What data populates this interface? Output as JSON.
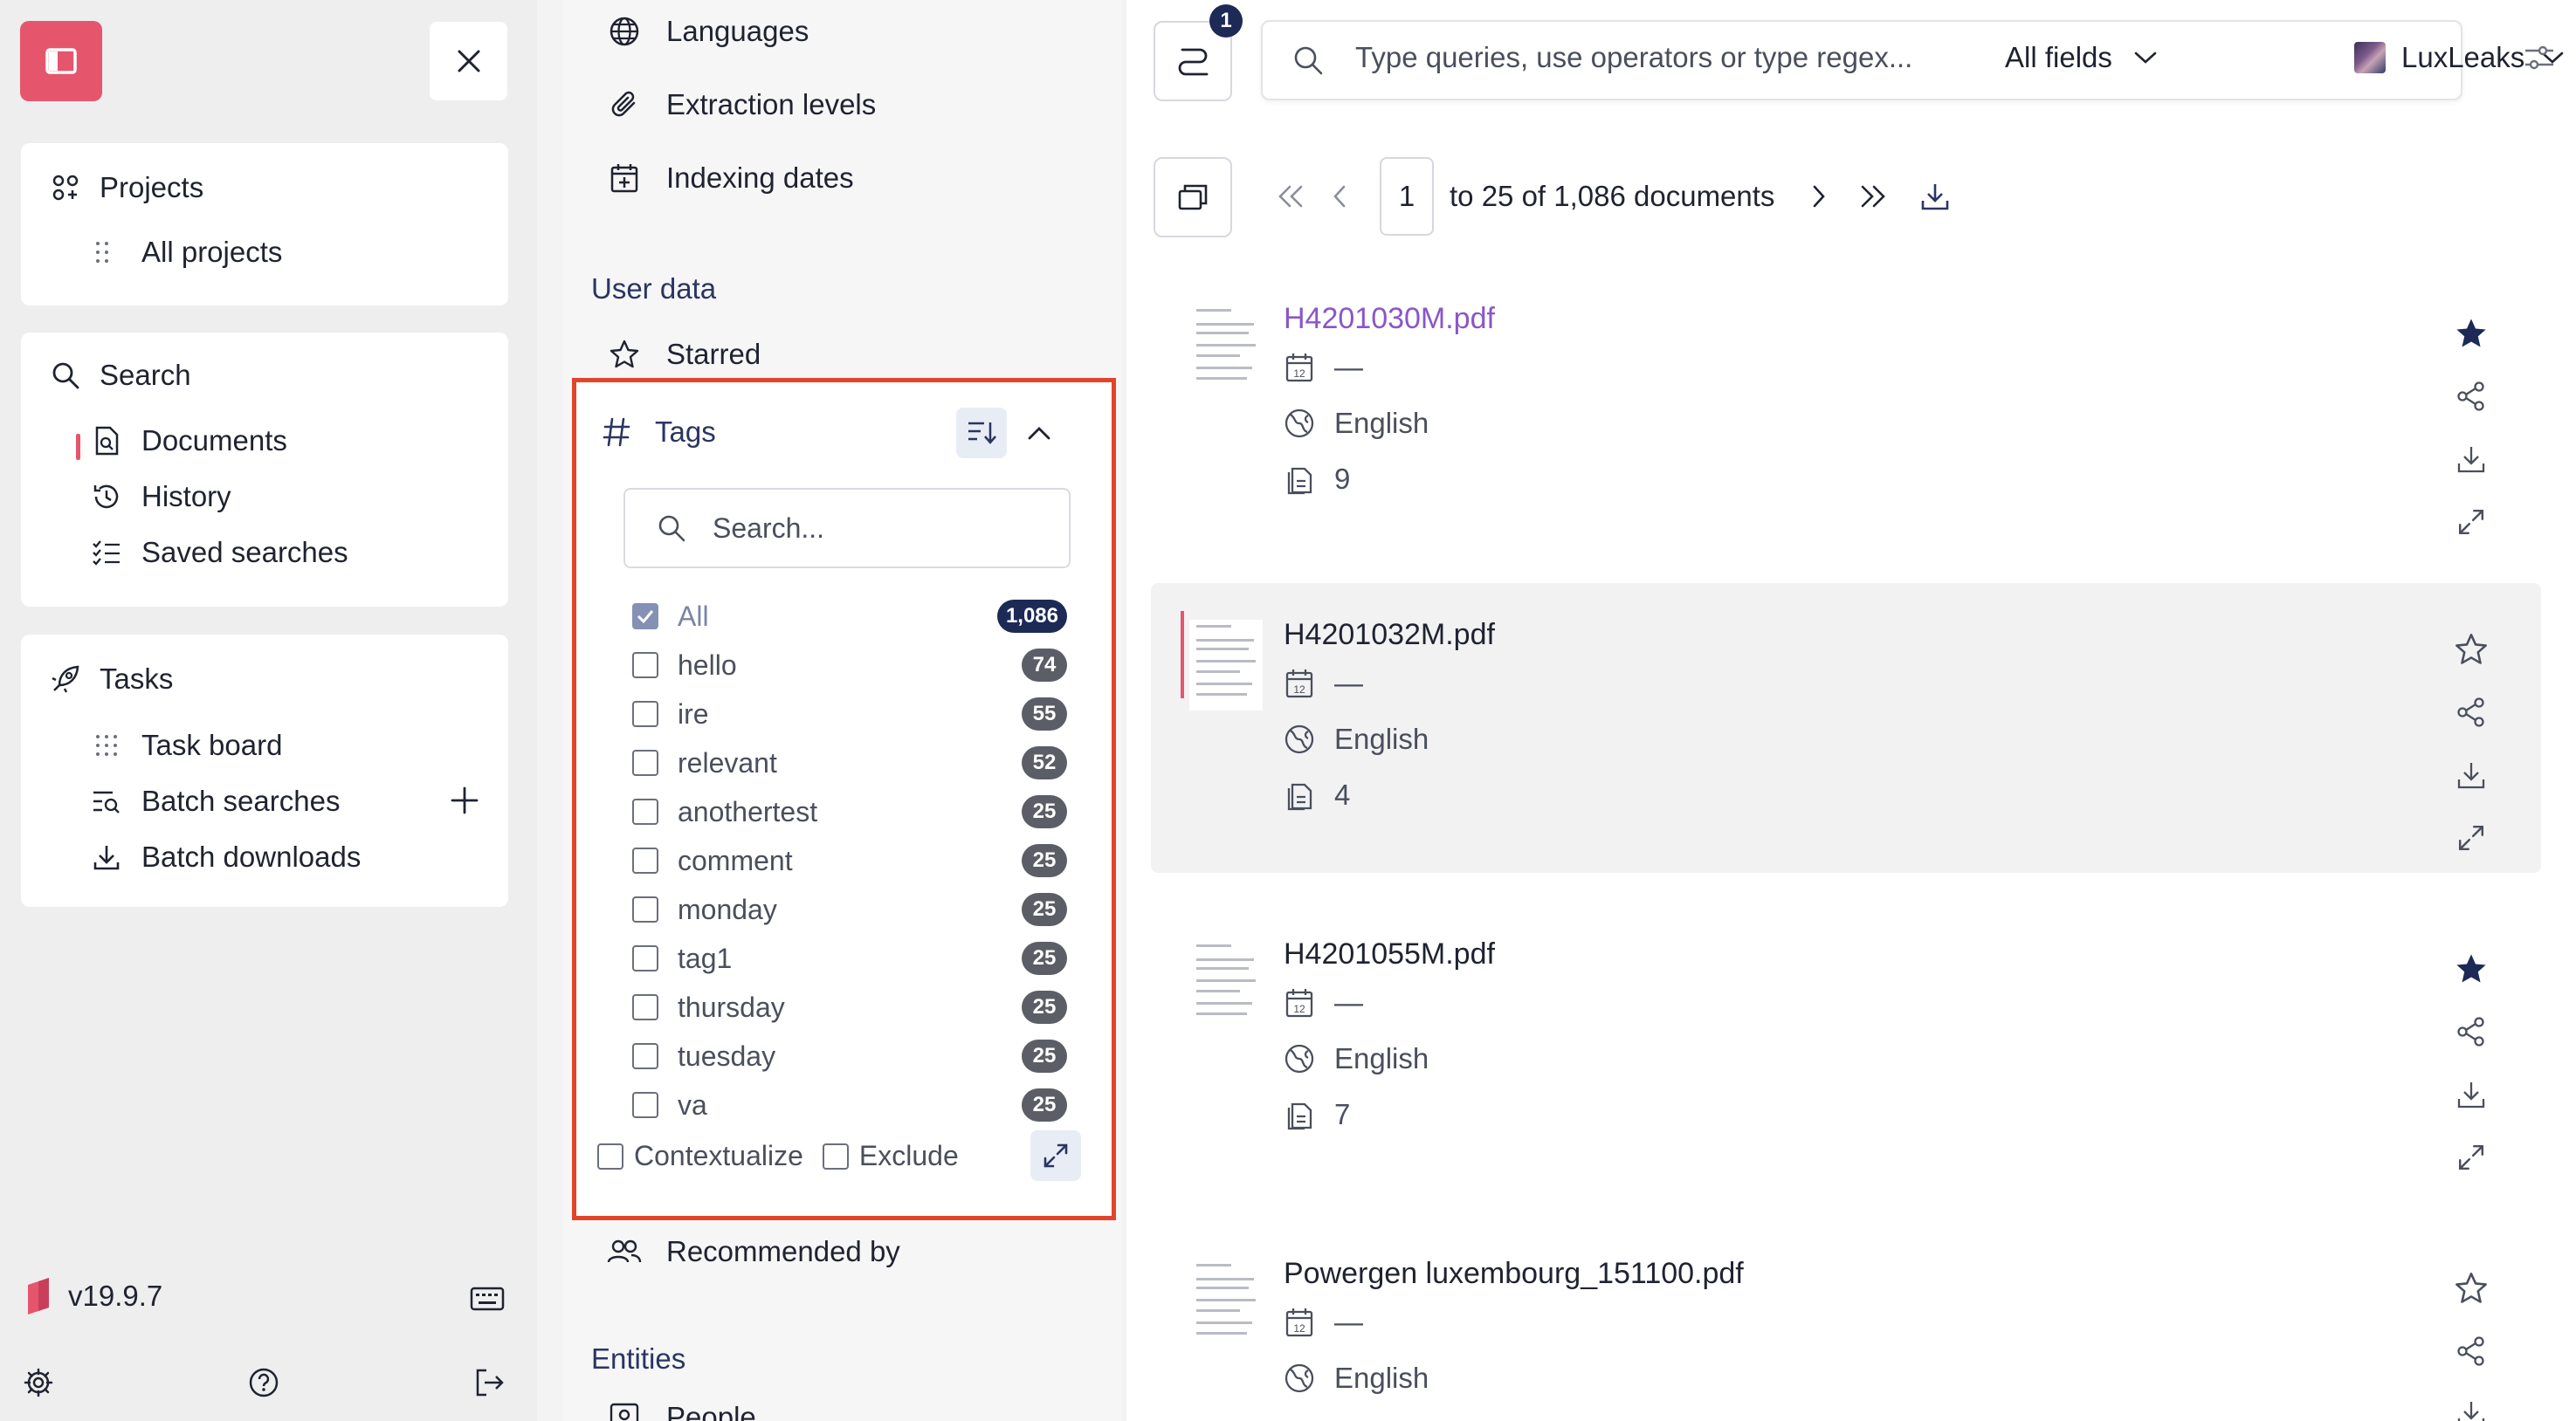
{
  "nav": {
    "projects": {
      "title": "Projects",
      "items": [
        "All projects"
      ]
    },
    "search": {
      "title": "Search",
      "items": [
        "Documents",
        "History",
        "Saved searches"
      ]
    },
    "tasks": {
      "title": "Tasks",
      "items": [
        "Task board",
        "Batch searches",
        "Batch downloads"
      ]
    },
    "version": "v19.9.7",
    "colors": {
      "brand": "#e5566d"
    }
  },
  "filters": {
    "top_items": [
      "Languages",
      "Extraction levels",
      "Indexing dates"
    ],
    "user_data_title": "User data",
    "starred": "Starred",
    "tags": {
      "title": "Tags",
      "search_placeholder": "Search...",
      "items": [
        {
          "label": "All",
          "count": "1,086",
          "checked": true
        },
        {
          "label": "hello",
          "count": "74",
          "checked": false
        },
        {
          "label": "ire",
          "count": "55",
          "checked": false
        },
        {
          "label": "relevant",
          "count": "52",
          "checked": false
        },
        {
          "label": "anothertest",
          "count": "25",
          "checked": false
        },
        {
          "label": "comment",
          "count": "25",
          "checked": false
        },
        {
          "label": "monday",
          "count": "25",
          "checked": false
        },
        {
          "label": "tag1",
          "count": "25",
          "checked": false
        },
        {
          "label": "thursday",
          "count": "25",
          "checked": false
        },
        {
          "label": "tuesday",
          "count": "25",
          "checked": false
        },
        {
          "label": "va",
          "count": "25",
          "checked": false
        }
      ],
      "contextualize": "Contextualize",
      "exclude": "Exclude"
    },
    "recommended_by": "Recommended by",
    "entities_title": "Entities",
    "people": "People"
  },
  "main": {
    "notif_count": "1",
    "search": {
      "placeholder": "Type queries, use operators or type regex...",
      "field": "All fields",
      "project": "LuxLeaks"
    },
    "pagination": {
      "page": "1",
      "summary": "to 25 of 1,086 documents"
    },
    "documents": [
      {
        "title": "H4201030M.pdf",
        "date": "—",
        "language": "English",
        "pages": "9",
        "starred": true,
        "visited": true
      },
      {
        "title": "H4201032M.pdf",
        "date": "—",
        "language": "English",
        "pages": "4",
        "starred": false,
        "visited": false
      },
      {
        "title": "H4201055M.pdf",
        "date": "—",
        "language": "English",
        "pages": "7",
        "starred": true,
        "visited": false
      },
      {
        "title": "Powergen luxembourg_151100.pdf",
        "date": "—",
        "language": "English",
        "pages": "",
        "starred": false,
        "visited": false
      }
    ]
  }
}
